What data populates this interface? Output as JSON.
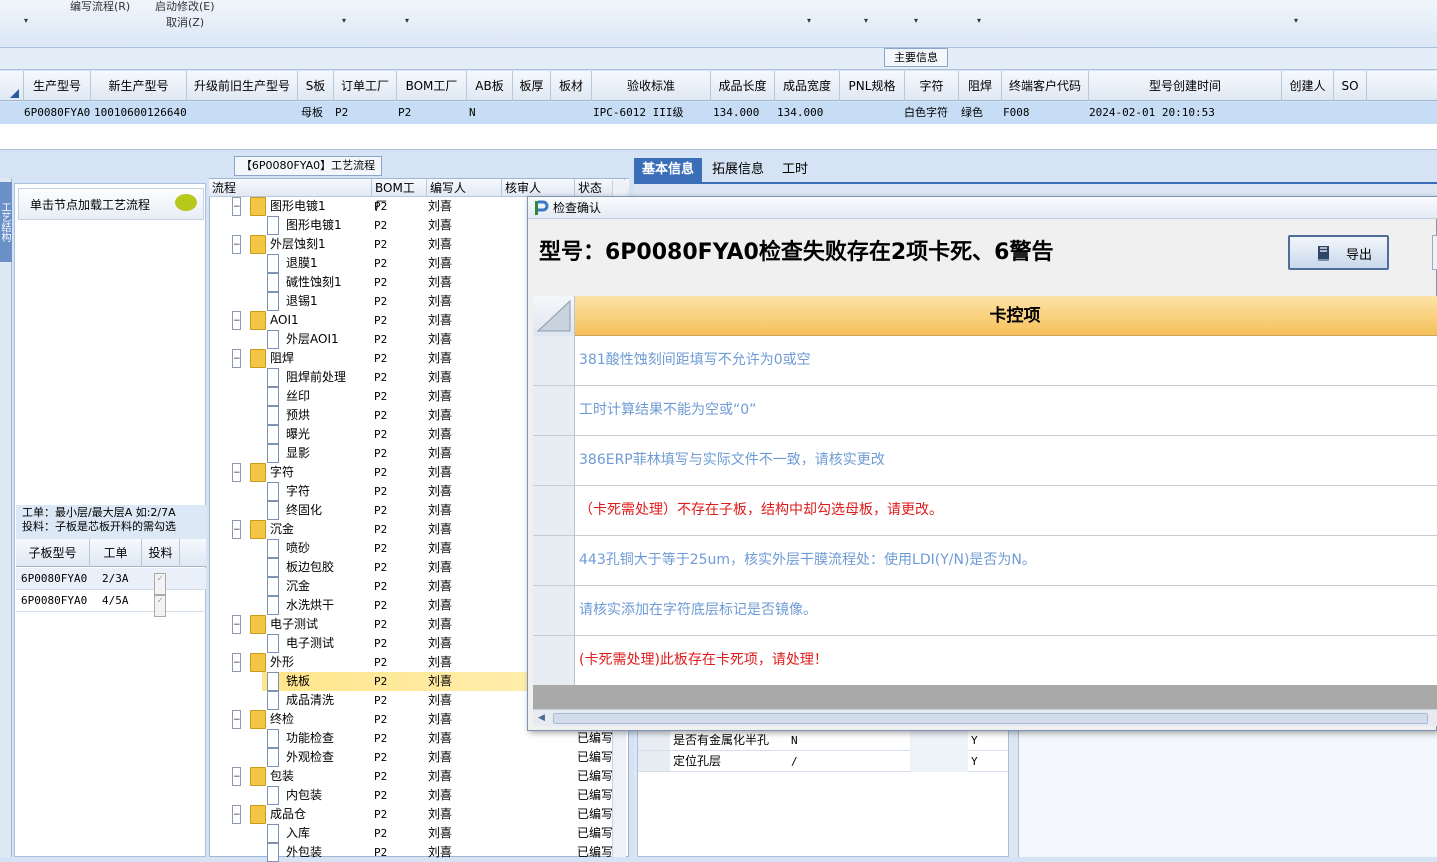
{
  "toolbar": {
    "flow_edit": "编写流程(R)",
    "start_modify": "启动修改(E)",
    "cancel": "取消(Z)"
  },
  "main_info": {
    "tab_label": "主要信息",
    "columns": [
      "生产型号",
      "新生产型号",
      "升级前旧生产型号",
      "S板",
      "订单工厂",
      "BOM工厂",
      "AB板",
      "板厚",
      "板材",
      "验收标准",
      "成品长度",
      "成品宽度",
      "PNL规格",
      "字符",
      "阻焊",
      "终端客户代码",
      "型号创建时间",
      "创建人",
      "SO"
    ],
    "row": {
      "prod_no": "6P0080FYA0",
      "new_prod_no": "10010600126640",
      "s_board": "母板",
      "order_factory": "P2",
      "bom_factory": "P2",
      "ab_board": "N",
      "accept_std": "IPC-6012 III级",
      "length": "134.000",
      "width": "134.000",
      "char": "白色字符",
      "solder": "绿色",
      "customer": "F008",
      "created": "2024-02-01 20:10:53"
    }
  },
  "left_panel": {
    "tab_text": "工艺结构",
    "load_label": "单击节点加载工艺流程",
    "info_line1": "工单：最小层/最大层A 如:2/7A",
    "info_line2": "投料：子板是芯板开料的需勾选",
    "sub_columns": [
      "子板型号",
      "工单",
      "投料"
    ],
    "sub_rows": [
      {
        "model": "6P0080FYA0",
        "order": "2/3A",
        "feed": "✓"
      },
      {
        "model": "6P0080FYA0",
        "order": "4/5A",
        "feed": "✓"
      }
    ]
  },
  "process": {
    "title": "【6P0080FYA0】工艺流程",
    "columns": [
      "流程",
      "BOM工厂",
      "编写人",
      "核审人",
      "状态"
    ],
    "rows": [
      {
        "name": "图形电镀1",
        "factory": "P2",
        "writer": "刘喜",
        "level": 0
      },
      {
        "name": "图形电镀1",
        "factory": "P2",
        "writer": "刘喜",
        "level": 1
      },
      {
        "name": "外层蚀刻1",
        "factory": "P2",
        "writer": "刘喜",
        "level": 0
      },
      {
        "name": "退膜1",
        "factory": "P2",
        "writer": "刘喜",
        "level": 1
      },
      {
        "name": "碱性蚀刻1",
        "factory": "P2",
        "writer": "刘喜",
        "level": 1
      },
      {
        "name": "退锡1",
        "factory": "P2",
        "writer": "刘喜",
        "level": 1
      },
      {
        "name": "AOI1",
        "factory": "P2",
        "writer": "刘喜",
        "level": 0
      },
      {
        "name": "外层AOI1",
        "factory": "P2",
        "writer": "刘喜",
        "level": 1
      },
      {
        "name": "阻焊",
        "factory": "P2",
        "writer": "刘喜",
        "level": 0
      },
      {
        "name": "阻焊前处理",
        "factory": "P2",
        "writer": "刘喜",
        "level": 1
      },
      {
        "name": "丝印",
        "factory": "P2",
        "writer": "刘喜",
        "level": 1
      },
      {
        "name": "预烘",
        "factory": "P2",
        "writer": "刘喜",
        "level": 1
      },
      {
        "name": "曝光",
        "factory": "P2",
        "writer": "刘喜",
        "level": 1
      },
      {
        "name": "显影",
        "factory": "P2",
        "writer": "刘喜",
        "level": 1
      },
      {
        "name": "字符",
        "factory": "P2",
        "writer": "刘喜",
        "level": 0
      },
      {
        "name": "字符",
        "factory": "P2",
        "writer": "刘喜",
        "level": 1
      },
      {
        "name": "终固化",
        "factory": "P2",
        "writer": "刘喜",
        "level": 1
      },
      {
        "name": "沉金",
        "factory": "P2",
        "writer": "刘喜",
        "level": 0
      },
      {
        "name": "喷砂",
        "factory": "P2",
        "writer": "刘喜",
        "level": 1
      },
      {
        "name": "板边包胶",
        "factory": "P2",
        "writer": "刘喜",
        "level": 1
      },
      {
        "name": "沉金",
        "factory": "P2",
        "writer": "刘喜",
        "level": 1
      },
      {
        "name": "水洗烘干",
        "factory": "P2",
        "writer": "刘喜",
        "level": 1
      },
      {
        "name": "电子测试",
        "factory": "P2",
        "writer": "刘喜",
        "level": 0
      },
      {
        "name": "电子测试",
        "factory": "P2",
        "writer": "刘喜",
        "level": 1
      },
      {
        "name": "外形",
        "factory": "P2",
        "writer": "刘喜",
        "level": 0
      },
      {
        "name": "铣板",
        "factory": "P2",
        "writer": "刘喜",
        "level": 1,
        "selected": true
      },
      {
        "name": "成品清洗",
        "factory": "P2",
        "writer": "刘喜",
        "level": 1
      },
      {
        "name": "终检",
        "factory": "P2",
        "writer": "刘喜",
        "level": 0
      },
      {
        "name": "功能检查",
        "factory": "P2",
        "writer": "刘喜",
        "level": 1,
        "status": "已编写"
      },
      {
        "name": "外观检查",
        "factory": "P2",
        "writer": "刘喜",
        "level": 1,
        "status": "已编写"
      },
      {
        "name": "包装",
        "factory": "P2",
        "writer": "刘喜",
        "level": 0,
        "status": "已编写"
      },
      {
        "name": "内包装",
        "factory": "P2",
        "writer": "刘喜",
        "level": 1,
        "status": "已编写"
      },
      {
        "name": "成品仓",
        "factory": "P2",
        "writer": "刘喜",
        "level": 0,
        "status": "已编写"
      },
      {
        "name": "入库",
        "factory": "P2",
        "writer": "刘喜",
        "level": 1,
        "status": "已编写"
      },
      {
        "name": "外包装",
        "factory": "P2",
        "writer": "刘喜",
        "level": 1,
        "status": "已编写"
      }
    ]
  },
  "right_tabs": [
    "基本信息",
    "拓展信息",
    "工时"
  ],
  "params": [
    {
      "name": "是否有金属化半孔",
      "val": "N",
      "flag": "Y"
    },
    {
      "name": "定位孔层",
      "val": "/",
      "flag": "Y"
    }
  ],
  "dialog": {
    "title": "检查确认",
    "heading": "型号：6P0080FYA0检查失败存在2项卡死、6警告",
    "export_label": "导出",
    "column_header": "卡控项",
    "items": [
      {
        "text": "381酸性蚀刻间距填写不允许为0或空",
        "kind": "warn"
      },
      {
        "text": "工时计算结果不能为空或“0”",
        "kind": "warn"
      },
      {
        "text": "386ERP菲林填写与实际文件不一致，请核实更改",
        "kind": "warn"
      },
      {
        "text": "（卡死需处理）不存在子板，结构中却勾选母板，请更改。",
        "kind": "dead"
      },
      {
        "text": "443孔铜大于等于25um，核实外层干膜流程处：使用LDI(Y/N)是否为N。",
        "kind": "warn"
      },
      {
        "text": "请核实添加在字符底层标记是否镜像。",
        "kind": "warn"
      },
      {
        "text": "(卡死需处理)此板存在卡死项，请处理！",
        "kind": "dead"
      }
    ]
  }
}
